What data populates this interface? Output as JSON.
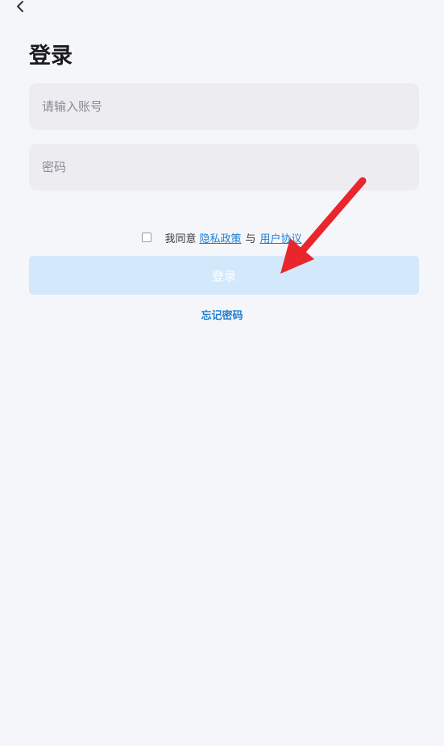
{
  "header": {
    "back_icon": "chevron-left-icon",
    "title": "登录"
  },
  "form": {
    "account_placeholder": "请输入账号",
    "account_value": "",
    "password_placeholder": "密码",
    "password_value": ""
  },
  "agreement": {
    "checked": false,
    "prefix": "我同意",
    "privacy_label": "隐私政策",
    "connector": "与",
    "terms_label": "用户协议"
  },
  "actions": {
    "login_label": "登录",
    "forgot_label": "忘记密码"
  },
  "annotation": {
    "arrow_color": "#e8262c"
  },
  "colors": {
    "background": "#f5f6fa",
    "field": "#ececf1",
    "link": "#1d7fd6",
    "button_disabled": "#d3e8fb"
  }
}
